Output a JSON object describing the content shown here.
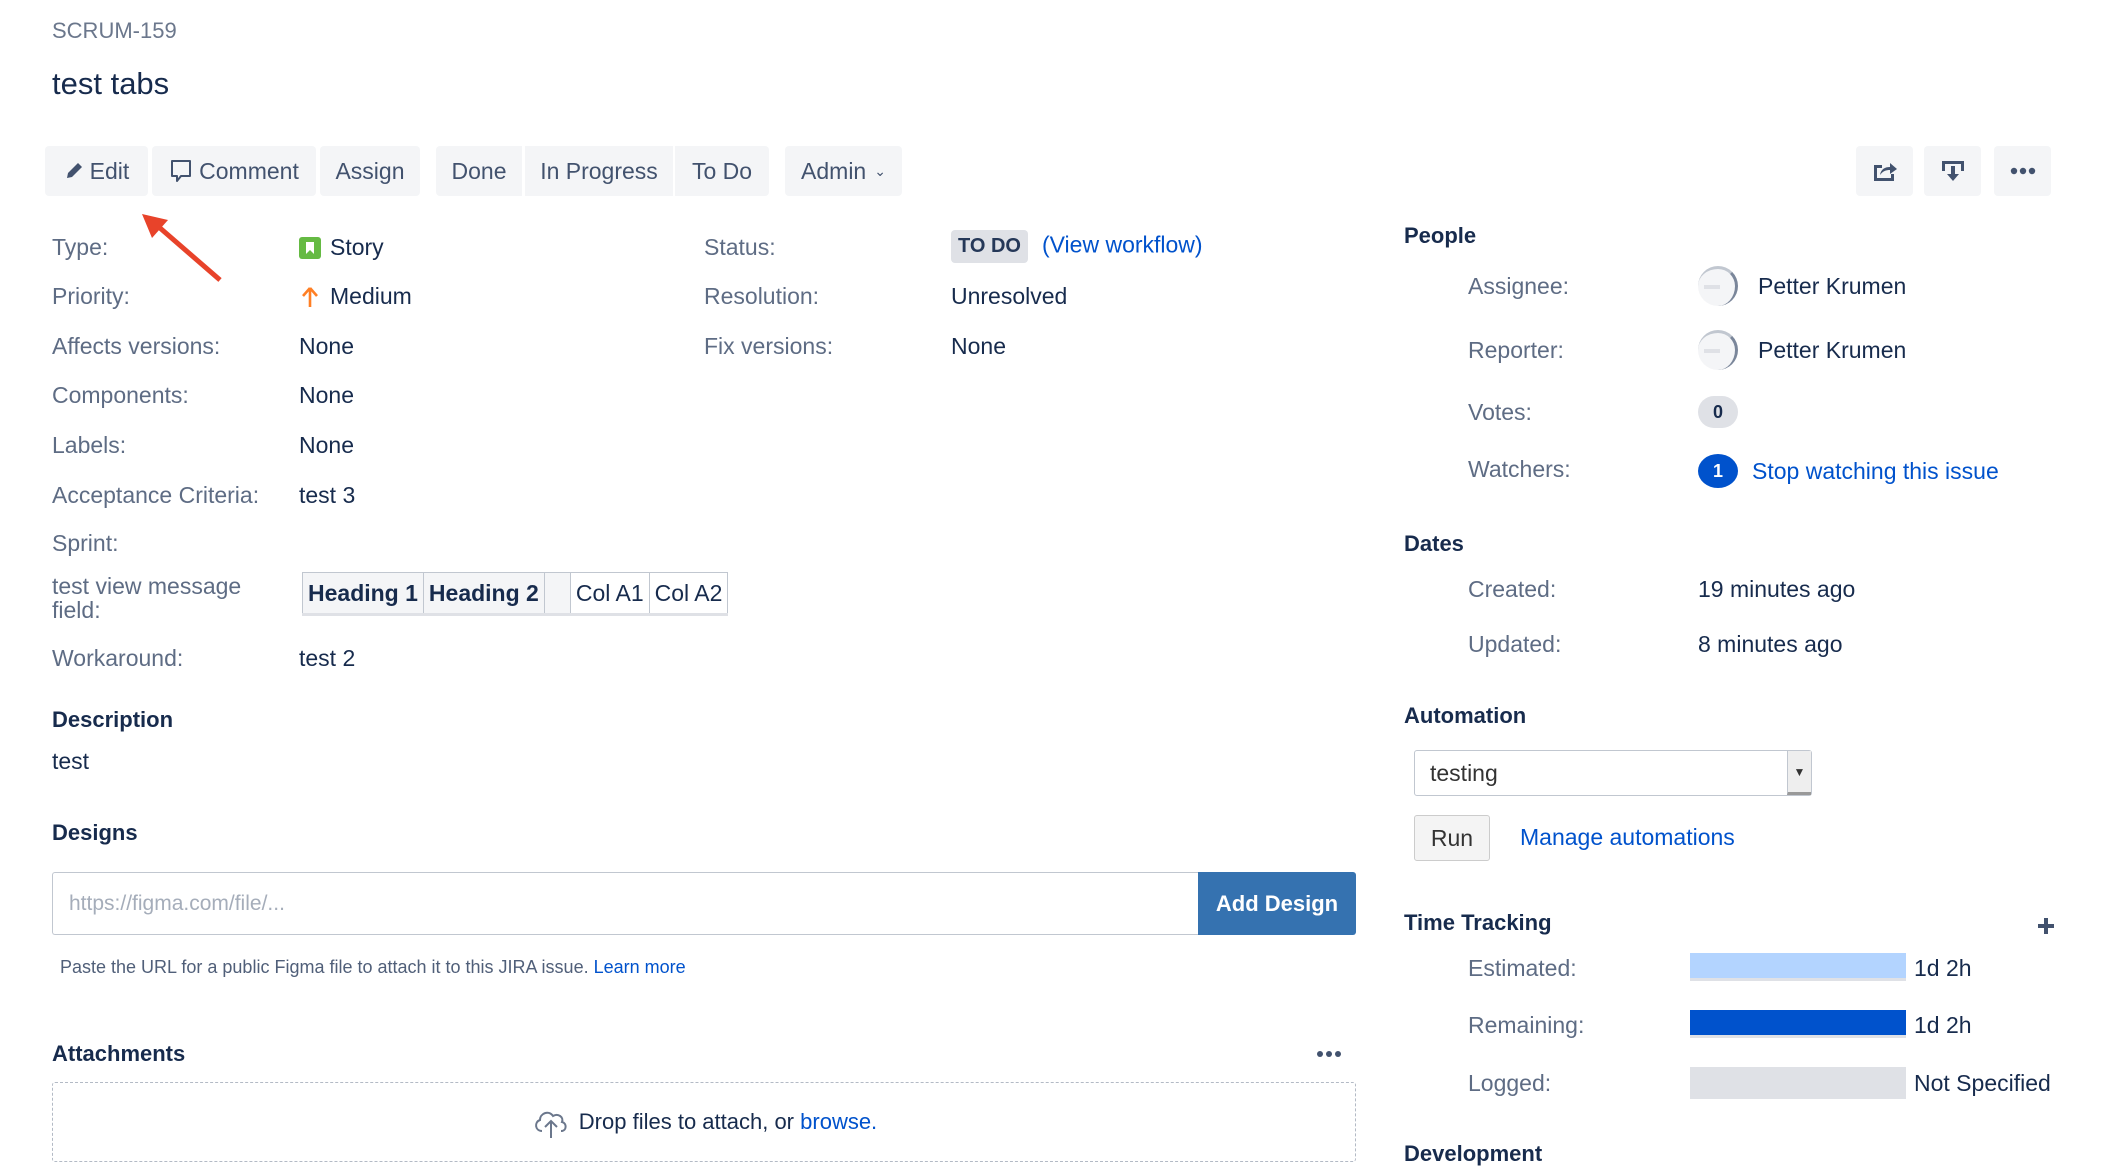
{
  "issue": {
    "key": "SCRUM-159",
    "title": "test tabs"
  },
  "toolbar": {
    "edit": "Edit",
    "comment": "Comment",
    "assign": "Assign",
    "done": "Done",
    "in_progress": "In Progress",
    "to_do": "To Do",
    "admin": "Admin",
    "right_icons": [
      "share-icon",
      "export-icon",
      "more-icon"
    ]
  },
  "details": {
    "type_label": "Type:",
    "type_value": "Story",
    "priority_label": "Priority:",
    "priority_value": "Medium",
    "affects_label": "Affects versions:",
    "affects_value": "None",
    "components_label": "Components:",
    "components_value": "None",
    "labels_label": "Labels:",
    "labels_value": "None",
    "acceptance_label": "Acceptance Criteria:",
    "acceptance_value": "test 3",
    "sprint_label": "Sprint:",
    "message_field_label_1": "test view message",
    "message_field_label_2": "field:",
    "message_table": [
      "Heading 1",
      "Heading 2",
      "",
      "Col A1",
      "Col A2"
    ],
    "workaround_label": "Workaround:",
    "workaround_value": "test 2",
    "status_label": "Status:",
    "status_value": "TO DO",
    "view_workflow": "(View workflow)",
    "resolution_label": "Resolution:",
    "resolution_value": "Unresolved",
    "fix_label": "Fix versions:",
    "fix_value": "None"
  },
  "description": {
    "heading": "Description",
    "text": "test"
  },
  "designs": {
    "heading": "Designs",
    "placeholder": "https://figma.com/file/...",
    "button": "Add Design",
    "help": "Paste the URL for a public Figma file to attach it to this JIRA issue.",
    "learn_more": "Learn more"
  },
  "attachments": {
    "heading": "Attachments",
    "drop_text": "Drop files to attach, or",
    "browse": "browse."
  },
  "people": {
    "heading": "People",
    "assignee_label": "Assignee:",
    "assignee": "Petter Krumen",
    "reporter_label": "Reporter:",
    "reporter": "Petter Krumen",
    "votes_label": "Votes:",
    "votes": "0",
    "watchers_label": "Watchers:",
    "watchers": "1",
    "stop_watching": "Stop watching this issue"
  },
  "dates": {
    "heading": "Dates",
    "created_label": "Created:",
    "created": "19 minutes ago",
    "updated_label": "Updated:",
    "updated": "8 minutes ago"
  },
  "automation": {
    "heading": "Automation",
    "selected": "testing",
    "run": "Run",
    "manage": "Manage automations"
  },
  "time_tracking": {
    "heading": "Time Tracking",
    "estimated_label": "Estimated:",
    "estimated": "1d 2h",
    "estimated_fill": 1.0,
    "remaining_label": "Remaining:",
    "remaining": "1d 2h",
    "remaining_fill": 1.0,
    "logged_label": "Logged:",
    "logged": "Not Specified",
    "logged_fill": 0.0
  },
  "development": {
    "heading": "Development"
  },
  "colors": {
    "accent": "#0052cc",
    "story": "#65ba43",
    "priority_medium": "#ff7f24",
    "annotation_arrow": "#e8432a"
  }
}
